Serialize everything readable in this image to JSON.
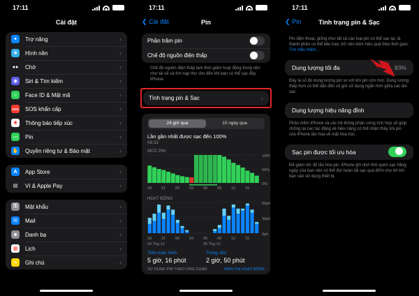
{
  "status": {
    "time": "17:11"
  },
  "panel1": {
    "title": "Cài đặt",
    "groups": [
      [
        {
          "label": "Trợ năng",
          "icon": "accessibility-icon",
          "color": "#0a84ff",
          "glyph": "✦"
        },
        {
          "label": "Hình nền",
          "icon": "wallpaper-icon",
          "color": "#32ade6",
          "glyph": "❋"
        },
        {
          "label": "Chờ",
          "icon": "standby-icon",
          "color": "#1c1c1e",
          "glyph": "●●"
        },
        {
          "label": "Siri & Tìm kiếm",
          "icon": "siri-icon",
          "color": "#5e5ce6",
          "glyph": "◉"
        },
        {
          "label": "Face ID & Mật mã",
          "icon": "face-id-icon",
          "color": "#30d158",
          "glyph": "☺"
        },
        {
          "label": "SOS khẩn cấp",
          "icon": "sos-icon",
          "color": "#ff3b30",
          "glyph": "SOS"
        },
        {
          "label": "Thông báo tiếp xúc",
          "icon": "exposure-notification-icon",
          "color": "#ffffff",
          "glyph": "✺"
        },
        {
          "label": "Pin",
          "icon": "battery-icon",
          "color": "#30d158",
          "glyph": "▭"
        },
        {
          "label": "Quyền riêng tư & Bảo mật",
          "icon": "privacy-hand-icon",
          "color": "#0a84ff",
          "glyph": "✋"
        }
      ],
      [
        {
          "label": "App Store",
          "icon": "app-store-icon",
          "color": "#0a84ff",
          "glyph": "A"
        },
        {
          "label": "Ví & Apple Pay",
          "icon": "wallet-icon",
          "color": "#1c1c1e",
          "glyph": "▤"
        }
      ],
      [
        {
          "label": "Mật khẩu",
          "icon": "key-icon",
          "color": "#8e8e93",
          "glyph": "⚿"
        },
        {
          "label": "Mail",
          "icon": "mail-icon",
          "color": "#0a84ff",
          "glyph": "✉"
        },
        {
          "label": "Danh bạ",
          "icon": "contacts-icon",
          "color": "#8e8e93",
          "glyph": "☻"
        },
        {
          "label": "Lịch",
          "icon": "calendar-icon",
          "color": "#ffffff",
          "glyph": "▦"
        },
        {
          "label": "Ghi chú",
          "icon": "notes-icon",
          "color": "#ffd60a",
          "glyph": "≡"
        }
      ]
    ]
  },
  "panel2": {
    "back": "Cài đặt",
    "title": "Pin",
    "rows": [
      {
        "label": "Phần trăm pin",
        "toggle": false
      },
      {
        "label": "Chế độ nguồn điện thấp",
        "toggle": false
      }
    ],
    "note": "Chế độ nguồn điện thấp tạm thời giảm hoạt động trong nền như tải về và tìm nạp thư cho đến khi bạn có thể sạc đầy iPhone.",
    "health_link": "Tình trạng pin & Sạc",
    "seg": [
      "24 giờ qua",
      "10 ngày qua"
    ],
    "last_charge_title": "Lần gần nhất được sạc đến 100%",
    "last_charge_time": "09:32",
    "battery_level_label": "MỨC PIN",
    "activity_label": "HOẠT ĐỘNG",
    "level_ticks": [
      "100%",
      "50%",
      "0%"
    ],
    "activity_ticks": [
      "60ph",
      "30ph",
      "0ph"
    ],
    "x_ticks": [
      "18",
      "21",
      "00",
      "03",
      "06",
      "09",
      "12",
      "15"
    ],
    "x_dates": [
      "24 Thg 12",
      "25 Thg 12"
    ],
    "screen_on_label": "Trên màn hình",
    "screen_on_value": "5 giờ, 16 phút",
    "background_label": "Trong nền",
    "background_value": "2 giờ, 50 phút",
    "usage_label": "SỬ DỤNG PIN THEO ỨNG DỤNG",
    "show_activity": "HIỂN THỊ HOẠT ĐỘNG"
  },
  "panel3": {
    "back": "Pin",
    "title": "Tình trạng pin & Sạc",
    "intro": "Pin điện thoại, giống như tất cả các loại pin có thể sạc lại, là thành phần có thể tiêu hao, trở nên kém hiệu quả theo thời gian.",
    "learn_more": "Tìm hiểu thêm...",
    "max_capacity_label": "Dung lượng tối đa",
    "max_capacity_value": "83%",
    "max_capacity_note": "Đây là số đo dung lượng pin so với khi pin còn mới. Dung lượng thấp hơn có thể dẫn đến số giờ sử dụng ngắn hơn giữa các lần sạc.",
    "peak_label": "Dung lượng hiệu năng đỉnh",
    "peak_note": "Phần mềm iPhone và các hệ thống phần cứng tích hợp sẽ giúp chống lại các tác động về hiệu năng có thể nhận thấy khi pin của iPhone lão hóa về mặt hóa học.",
    "optimized_label": "Sạc pin được tối ưu hóa",
    "optimized_on": true,
    "optimized_note": "Để giảm tốc độ lão hóa pin, iPhone ghi nhớ thói quen sạc hằng ngày của bạn nên có thể đợi hoàn tất sạc quá 80% cho tới khi bạn cần sử dụng thiết bị."
  },
  "colors": {
    "accent": "#0a84ff",
    "green": "#30d158",
    "highlight": "#e5262a",
    "arrow": "#d0161c"
  },
  "chart_data": [
    {
      "type": "area",
      "title": "MỨC PIN",
      "x": [
        "18",
        "19",
        "20",
        "21",
        "22",
        "23",
        "00",
        "01",
        "02",
        "03",
        "04",
        "05",
        "06",
        "07",
        "08",
        "09",
        "10",
        "11",
        "12",
        "13",
        "14",
        "15",
        "16",
        "17"
      ],
      "values": [
        62,
        56,
        50,
        46,
        40,
        34,
        28,
        24,
        21,
        20,
        100,
        100,
        100,
        100,
        100,
        100,
        94,
        84,
        72,
        64,
        55,
        44,
        36,
        26
      ],
      "ylim": [
        0,
        100
      ],
      "charging_hours": [
        "03",
        "04",
        "05",
        "06",
        "07",
        "08"
      ]
    },
    {
      "type": "bar",
      "title": "HOẠT ĐỘNG",
      "x": [
        "18",
        "19",
        "20",
        "21",
        "22",
        "23",
        "00",
        "01",
        "02",
        "03",
        "04",
        "05",
        "06",
        "07",
        "08",
        "09",
        "10",
        "11",
        "12",
        "13",
        "14",
        "15",
        "16",
        "17"
      ],
      "series": [
        {
          "values": [
            18,
            24,
            40,
            28,
            46,
            36,
            20,
            10,
            3,
            0,
            0,
            0,
            0,
            0,
            4,
            10,
            34,
            26,
            50,
            38,
            44,
            54,
            40,
            18
          ]
        },
        {
          "values": [
            12,
            14,
            16,
            12,
            8,
            10,
            6,
            4,
            3,
            0,
            0,
            0,
            0,
            0,
            4,
            6,
            14,
            8,
            6,
            10,
            4,
            4,
            6,
            4
          ]
        }
      ],
      "ylim": [
        0,
        60
      ]
    }
  ]
}
